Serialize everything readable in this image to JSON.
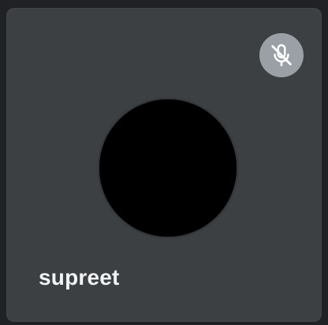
{
  "participant": {
    "name": "supreet",
    "microphone_muted": true,
    "mute_icon": "mic-off-icon"
  },
  "colors": {
    "page_background": "#202124",
    "tile_background": "#3c4043",
    "avatar": "#000000",
    "mute_badge": "#9aa0a6",
    "name_text": "#f1f3f4"
  }
}
